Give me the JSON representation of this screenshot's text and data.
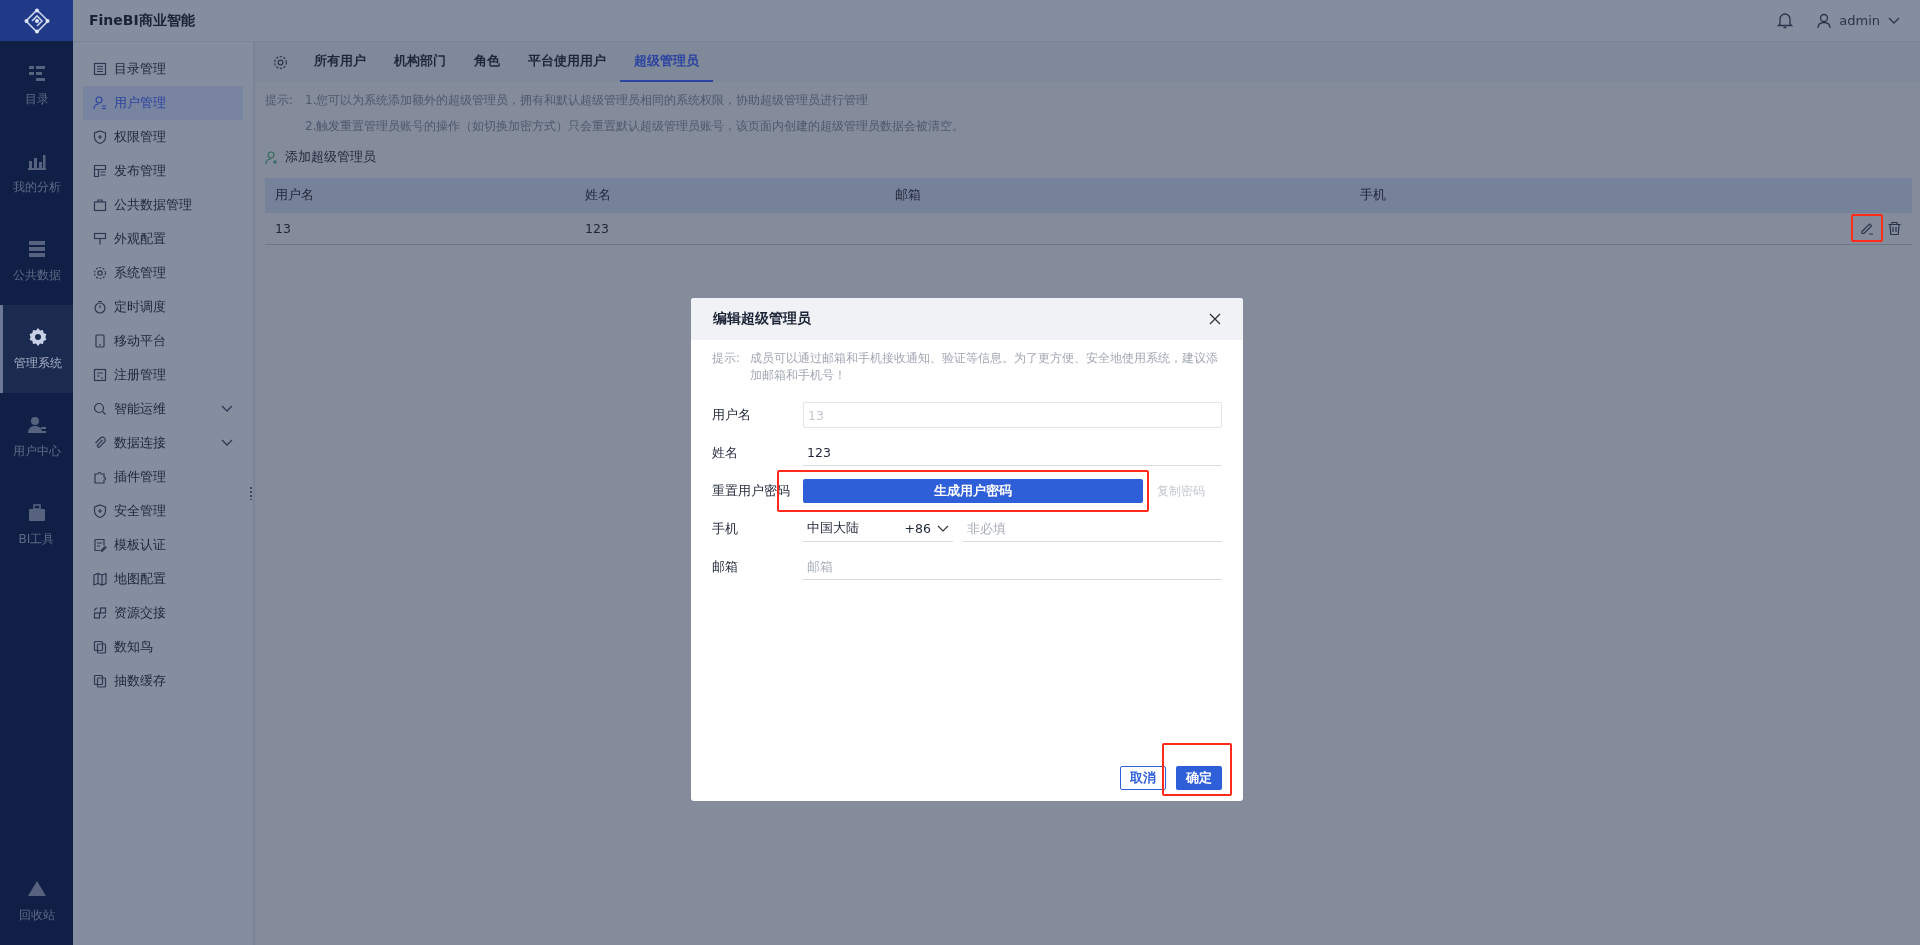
{
  "app_bar": {
    "title": "FineBI商业智能",
    "user": "admin"
  },
  "rail": {
    "items": [
      {
        "label": "目录",
        "selected": false
      },
      {
        "label": "我的分析",
        "selected": false
      },
      {
        "label": "公共数据",
        "selected": false
      },
      {
        "label": "管理系统",
        "selected": true
      },
      {
        "label": "用户中心",
        "selected": false
      },
      {
        "label": "BI工具",
        "selected": false
      }
    ],
    "bottom": "回收站"
  },
  "menu": {
    "items": [
      {
        "label": "目录管理",
        "selected": false,
        "kind": "link"
      },
      {
        "label": "用户管理",
        "selected": true,
        "kind": "link"
      },
      {
        "label": "权限管理",
        "selected": false,
        "kind": "link"
      },
      {
        "label": "发布管理",
        "selected": false,
        "kind": "link"
      },
      {
        "label": "公共数据管理",
        "selected": false,
        "kind": "link"
      },
      {
        "label": "外观配置",
        "selected": false,
        "kind": "link"
      },
      {
        "label": "系统管理",
        "selected": false,
        "kind": "link"
      },
      {
        "label": "定时调度",
        "selected": false,
        "kind": "link"
      },
      {
        "label": "移动平台",
        "selected": false,
        "kind": "link"
      },
      {
        "label": "注册管理",
        "selected": false,
        "kind": "link"
      },
      {
        "label": "智能运维",
        "selected": false,
        "kind": "group"
      },
      {
        "label": "数据连接",
        "selected": false,
        "kind": "group"
      },
      {
        "label": "插件管理",
        "selected": false,
        "kind": "link"
      },
      {
        "label": "安全管理",
        "selected": false,
        "kind": "link"
      },
      {
        "label": "模板认证",
        "selected": false,
        "kind": "link"
      },
      {
        "label": "地图配置",
        "selected": false,
        "kind": "link"
      },
      {
        "label": "资源交接",
        "selected": false,
        "kind": "link"
      },
      {
        "label": "数知鸟",
        "selected": false,
        "kind": "link"
      },
      {
        "label": "抽数缓存",
        "selected": false,
        "kind": "link"
      }
    ]
  },
  "tabs": [
    {
      "label": "所有用户",
      "selected": false
    },
    {
      "label": "机构部门",
      "selected": false
    },
    {
      "label": "角色",
      "selected": false
    },
    {
      "label": "平台使用用户",
      "selected": false
    },
    {
      "label": "超级管理员",
      "selected": true
    }
  ],
  "hints": {
    "label": "提示:",
    "lines": [
      "1.您可以为系统添加额外的超级管理员，拥有和默认超级管理员相同的系统权限，协助超级管理员进行管理",
      "2.触发重置管理员账号的操作（如切换加密方式）只会重置默认超级管理员账号，该页面内创建的超级管理员数据会被清空。"
    ]
  },
  "add_button": "添加超级管理员",
  "table": {
    "columns": [
      "用户名",
      "姓名",
      "邮箱",
      "手机"
    ],
    "rows": [
      {
        "username": "13",
        "name": "123",
        "edit_highlighted": true
      }
    ]
  },
  "dialog": {
    "title": "编辑超级管理员",
    "hint_label": "提示:",
    "hint": "成员可以通过邮箱和手机接收通知、验证等信息。为了更方便、安全地使用系统，建议添加邮箱和手机号！",
    "fields": [
      {
        "kind": "text",
        "label": "用户名",
        "value": "13",
        "disabled": true
      },
      {
        "kind": "text",
        "label": "姓名",
        "value": "123",
        "disabled": false
      },
      {
        "kind": "password",
        "label": "重置用户密码",
        "button": "生成用户密码",
        "secondary": "复制密码",
        "highlighted": true
      },
      {
        "kind": "phone",
        "label": "手机",
        "region": "中国大陆",
        "code": "+86",
        "placeholder": "非必填"
      },
      {
        "kind": "email",
        "label": "邮箱",
        "placeholder": "邮箱"
      }
    ],
    "cancel": "取消",
    "ok": {
      "label": "确定",
      "highlighted": true
    }
  }
}
